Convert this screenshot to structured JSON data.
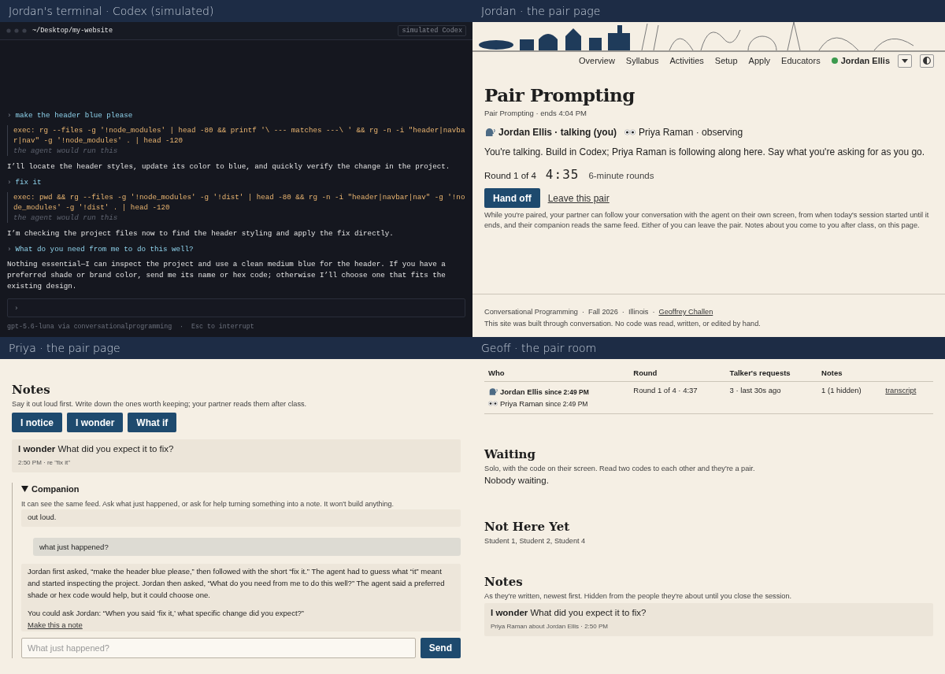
{
  "terminal": {
    "title": "Jordan's terminal · Codex (simulated)",
    "path": "~/Desktop/my-website",
    "badge": "simulated Codex",
    "entries": [
      {
        "kind": "user",
        "mark": "›",
        "text": "make the header blue please"
      },
      {
        "kind": "exec",
        "text": "exec: rg --files -g '!node_modules' | head -80 && printf '\\ --- matches ---\\ ' && rg -n -i \"header|navbar|nav\" -g '!node_modules' . | head -120",
        "note": "the agent would run this"
      },
      {
        "kind": "reply",
        "text": "I’ll locate the header styles, update its color to blue, and quickly verify the change in the project."
      },
      {
        "kind": "user",
        "mark": "›",
        "text": "fix it"
      },
      {
        "kind": "exec",
        "text": "exec: pwd && rg --files -g '!node_modules' -g '!dist' | head -80 && rg -n -i \"header|navbar|nav\" -g '!node_modules' -g '!dist' . | head -120",
        "note": "the agent would run this"
      },
      {
        "kind": "reply",
        "text": "I’m checking the project files now to find the header styling and apply the fix directly."
      },
      {
        "kind": "user",
        "mark": "›",
        "text": "What do you need from me to do this well?"
      },
      {
        "kind": "reply",
        "text": "Nothing essential—I can inspect the project and use a clean medium blue for the header. If you have a preferred shade or brand color, send me its name or hex code; otherwise I’ll choose one that fits the existing design."
      }
    ],
    "input_mark": "›",
    "footer": "gpt-5.6-luna via conversationalprogramming  ·  Esc to interrupt"
  },
  "jordan_page": {
    "title": "Jordan · the pair page",
    "nav": [
      "Overview",
      "Syllabus",
      "Activities",
      "Setup",
      "Apply",
      "Educators"
    ],
    "user": "Jordan Ellis",
    "heading": "Pair Prompting",
    "subtitle": "Pair Prompting · ends 4:04 PM",
    "people": [
      {
        "kind": "talker",
        "label": "Jordan Ellis · talking (you)"
      },
      {
        "kind": "observer",
        "label": "Priya Raman · observing"
      }
    ],
    "message": "You're talking. Build in Codex; Priya Raman is following along here. Say what you're asking for as you go.",
    "round": "Round 1 of 4",
    "timer": "4:35",
    "round_length": "6-minute rounds",
    "primary_button": "Hand off",
    "leave_link": "Leave this pair",
    "explainer": "While you're paired, your partner can follow your conversation with the agent on their own screen, from when today's session started until it ends, and their companion reads the same feed. Either of you can leave the pair. Notes about you come to you after class, on this page.",
    "footer": {
      "items": [
        "Conversational Programming",
        "Fall 2026",
        "Illinois"
      ],
      "separator": "·",
      "link": "Geoffrey Challen",
      "note": "This site was built through conversation. No code was read, written, or edited by hand."
    }
  },
  "priya_page": {
    "title": "Priya · the pair page",
    "notes_heading": "Notes",
    "notes_hint": "Say it out loud first. Write down the ones worth keeping; your partner reads them after class.",
    "note_buttons": [
      "I notice",
      "I wonder",
      "What if"
    ],
    "notes": [
      {
        "label": "I wonder",
        "text": "What did you expect it to fix?",
        "meta": "2:50 PM · re \"fix it\""
      }
    ],
    "companion": {
      "expanded": true,
      "title": "Companion",
      "hint": "It can see the same feed. Ask what just happened, or ask for help turning something into a note. It won't build anything.",
      "messages": [
        {
          "kind": "reply",
          "paragraphs": [
            "out loud."
          ]
        },
        {
          "kind": "question",
          "text": "what just happened?"
        },
        {
          "kind": "reply",
          "paragraphs": [
            "Jordan first asked, “make the header blue please,” then followed with the short “fix it.” The agent had to guess what “it” meant and started inspecting the project. Jordan then asked, “What do you need from me to do this well?” The agent said a preferred shade or hex code would help, but it could choose one.",
            "You could ask Jordan: “When you said ‘fix it,’ what specific change did you expect?”"
          ],
          "action": "Make this a note"
        }
      ],
      "placeholder": "What just happened?",
      "send": "Send"
    }
  },
  "geoff_page": {
    "title": "Geoff · the pair room",
    "table": {
      "columns": [
        "Who",
        "Round",
        "Talker's requests",
        "Notes"
      ],
      "rows": [
        {
          "people": [
            {
              "kind": "talker",
              "name": "Jordan Ellis",
              "since": "since 2:49 PM"
            },
            {
              "kind": "observer",
              "name": "Priya Raman",
              "since": "since 2:49 PM"
            }
          ],
          "round": "Round 1 of 4 · 4:37",
          "requests": "3 · last 30s ago",
          "notes": "1 (1 hidden)",
          "link": "transcript"
        }
      ]
    },
    "waiting": {
      "heading": "Waiting",
      "hint": "Solo, with the code on their screen. Read two codes to each other and they're a pair.",
      "text": "Nobody waiting."
    },
    "not_here": {
      "heading": "Not Here Yet",
      "text": "Student 1, Student 2, Student 4"
    },
    "notes": {
      "heading": "Notes",
      "hint": "As they're written, newest first. Hidden from the people they're about until you close the session.",
      "items": [
        {
          "label": "I wonder",
          "text": "What did you expect it to fix?",
          "meta": "Priya Raman about Jordan Ellis · 2:50 PM"
        }
      ]
    }
  }
}
